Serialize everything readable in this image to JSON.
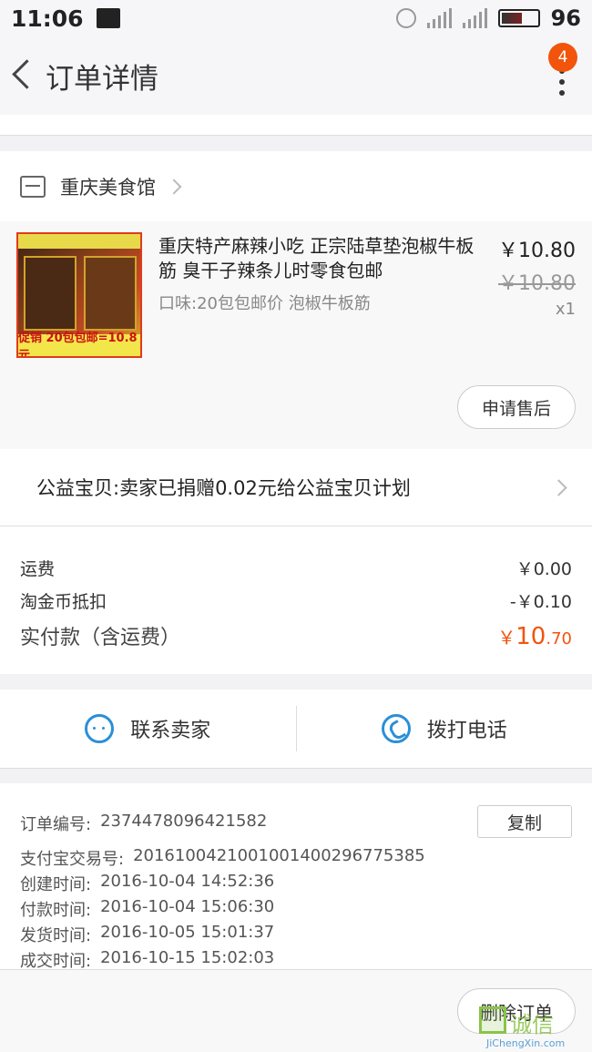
{
  "status_bar": {
    "time": "11:06",
    "battery": "96"
  },
  "header": {
    "title": "订单详情",
    "badge_count": "4"
  },
  "shop": {
    "name": "重庆美食馆"
  },
  "product": {
    "title": "重庆特产麻辣小吃 正宗陆草垫泡椒牛板筋 臭干子辣条儿时零食包邮",
    "spec": "口味:20包包邮价 泡椒牛板筋",
    "price": "￥10.80",
    "original_price": "￥10.80",
    "quantity": "x1",
    "image_promo_text": "促销 20包包邮=10.8元",
    "after_sale_label": "申请售后"
  },
  "charity": {
    "text": "公益宝贝:卖家已捐赠0.02元给公益宝贝计划"
  },
  "fees": {
    "shipping_label": "运费",
    "shipping_value": "￥0.00",
    "coin_label": "淘金币抵扣",
    "coin_value": "-￥0.10",
    "total_label": "实付款（含运费）",
    "total_currency": "￥",
    "total_int": "10",
    "total_dec": ".70"
  },
  "contact": {
    "seller_label": "联系卖家",
    "call_label": "拨打电话"
  },
  "order_info": {
    "order_no_label": "订单编号:",
    "order_no": "2374478096421582",
    "copy_label": "复制",
    "alipay_label": "支付宝交易号:",
    "alipay_no": "2016100421001001400296775385",
    "created_label": "创建时间:",
    "created": "2016-10-04 14:52:36",
    "paid_label": "付款时间:",
    "paid": "2016-10-04 15:06:30",
    "shipped_label": "发货时间:",
    "shipped": "2016-10-05 15:01:37",
    "completed_label": "成交时间:",
    "completed": "2016-10-15 15:02:03"
  },
  "bottom": {
    "delete_label": "删除订单"
  },
  "watermark": {
    "text": "诚信",
    "sub": "JiChengXin.com"
  },
  "colors": {
    "accent": "#f2540c",
    "link_blue": "#2a8fd8"
  }
}
